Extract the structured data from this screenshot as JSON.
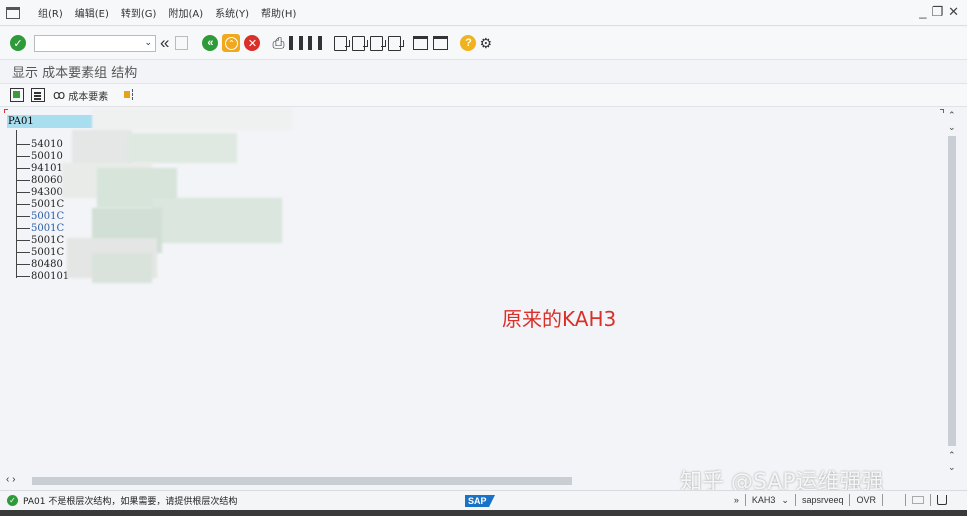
{
  "menubar": {
    "items": [
      "组(R)",
      "编辑(E)",
      "转到(G)",
      "附加(A)",
      "系统(Y)",
      "帮助(H)"
    ],
    "window_controls": [
      "_",
      "❐",
      "✕"
    ]
  },
  "toolbar": {
    "command_value": "",
    "command_dropdown": "⌄",
    "nav_back": "«",
    "print": "⎙"
  },
  "title": {
    "text": "显示 成本要素组 结构"
  },
  "apptoolbar": {
    "glasses_icon": "ꝏ",
    "cost_element_label": "成本要素"
  },
  "tree": {
    "root": "PA01",
    "items": [
      {
        "code": "54010",
        "color": "normal"
      },
      {
        "code": "50010",
        "color": "normal"
      },
      {
        "code": "94101",
        "color": "normal"
      },
      {
        "code": "80060",
        "color": "normal"
      },
      {
        "code": "94300",
        "color": "normal"
      },
      {
        "code": "5001C",
        "color": "normal"
      },
      {
        "code": "5001C",
        "color": "blue"
      },
      {
        "code": "5001C",
        "color": "blue"
      },
      {
        "code": "5001C",
        "color": "normal"
      },
      {
        "code": "5001C",
        "color": "normal"
      },
      {
        "code": "80480",
        "color": "normal"
      },
      {
        "code": "800101",
        "color": "normal"
      }
    ]
  },
  "annotation": {
    "text": "原来的KAH3"
  },
  "status": {
    "message": "PA01 不是根层次结构，如果需要，请提供根层次结构",
    "sap_logo": "SAP",
    "nav": "»",
    "transaction": "KAH3",
    "transaction_dd": "⌄",
    "server": "sapsrveeq",
    "mode": "OVR"
  },
  "watermark": {
    "text": "知乎 @SAP运维强强"
  },
  "colors": {
    "selection": "#a9def0",
    "annotation": "#d9302a",
    "ok_green": "#2e9a3a",
    "sap_blue": "#1873c8"
  }
}
